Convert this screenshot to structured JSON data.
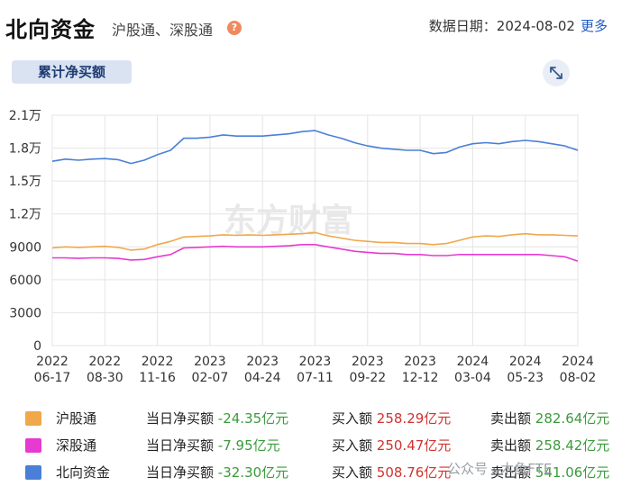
{
  "header": {
    "title": "北向资金",
    "subtitle": "沪股通、深股通",
    "help_glyph": "?",
    "date_label": "数据日期：",
    "date_value": "2024-08-02",
    "more_label": "更多"
  },
  "tab": {
    "label": "累计净买额"
  },
  "watermark": "东方财富",
  "chart_data": {
    "type": "line",
    "ylim": [
      0,
      21000
    ],
    "yticks": [
      "0",
      "3000",
      "6000",
      "9000",
      "1.2万",
      "1.5万",
      "1.8万",
      "2.1万"
    ],
    "xticks": [
      [
        "2022",
        "06-17"
      ],
      [
        "2022",
        "08-30"
      ],
      [
        "2022",
        "11-16"
      ],
      [
        "2023",
        "02-07"
      ],
      [
        "2023",
        "04-24"
      ],
      [
        "2023",
        "07-11"
      ],
      [
        "2023",
        "09-22"
      ],
      [
        "2023",
        "12-12"
      ],
      [
        "2024",
        "03-04"
      ],
      [
        "2024",
        "05-23"
      ],
      [
        "2024",
        "08-02"
      ]
    ],
    "x_index": [
      0,
      4,
      8,
      12,
      16,
      20,
      24,
      28,
      32,
      36,
      40
    ],
    "series": [
      {
        "name": "北向资金",
        "color": "#4a7fd8",
        "values": [
          16800,
          17000,
          16900,
          17000,
          17050,
          16950,
          16600,
          16900,
          17400,
          17800,
          18900,
          18900,
          19000,
          19200,
          19100,
          19100,
          19100,
          19200,
          19300,
          19500,
          19600,
          19200,
          18900,
          18500,
          18200,
          18000,
          17900,
          17800,
          17800,
          17500,
          17600,
          18100,
          18400,
          18500,
          18400,
          18600,
          18700,
          18600,
          18400,
          18200,
          17800
        ]
      },
      {
        "name": "沪股通",
        "color": "#f0a84a",
        "values": [
          8900,
          9000,
          8950,
          9000,
          9050,
          8950,
          8700,
          8800,
          9200,
          9500,
          9900,
          9950,
          10000,
          10100,
          10050,
          10100,
          10050,
          10100,
          10150,
          10200,
          10300,
          10000,
          9800,
          9600,
          9500,
          9400,
          9400,
          9300,
          9300,
          9200,
          9300,
          9600,
          9900,
          10000,
          9950,
          10100,
          10200,
          10100,
          10100,
          10050,
          10000
        ]
      },
      {
        "name": "深股通",
        "color": "#e63ad0",
        "values": [
          8000,
          8000,
          7950,
          8000,
          8000,
          7950,
          7800,
          7850,
          8100,
          8300,
          8900,
          8950,
          9000,
          9050,
          9000,
          9000,
          9000,
          9050,
          9100,
          9200,
          9200,
          9000,
          8800,
          8600,
          8500,
          8400,
          8400,
          8300,
          8300,
          8200,
          8200,
          8300,
          8300,
          8300,
          8300,
          8300,
          8300,
          8300,
          8200,
          8100,
          7700
        ]
      }
    ]
  },
  "legend": [
    {
      "name": "沪股通",
      "color": "#f0a84a",
      "net_label": "当日净买额",
      "net_value": "-24.35亿元",
      "buy_label": "买入额",
      "buy_value": "258.29亿元",
      "sell_label": "卖出额",
      "sell_value": "282.64亿元"
    },
    {
      "name": "深股通",
      "color": "#e63ad0",
      "net_label": "当日净买额",
      "net_value": "-7.95亿元",
      "buy_label": "买入额",
      "buy_value": "250.47亿元",
      "sell_label": "卖出额",
      "sell_value": "258.42亿元"
    },
    {
      "name": "北向资金",
      "color": "#4a7fd8",
      "net_label": "当日净买额",
      "net_value": "-32.30亿元",
      "buy_label": "买入额",
      "buy_value": "508.76亿元",
      "sell_label": "卖出额",
      "sell_value": "541.06亿元"
    }
  ],
  "bottom_watermark": "公众号 · 木鱼FTE"
}
